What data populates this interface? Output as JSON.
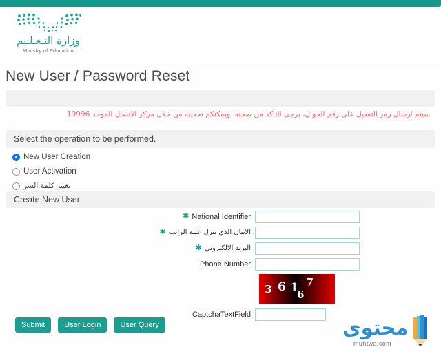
{
  "brand": {
    "logo_icon": "ministry-dots-logo",
    "name_ar": "وزارة التـعـلـيم",
    "name_en": "Ministry of Education",
    "accent_color": "#15998b"
  },
  "page": {
    "title": "New User / Password Reset"
  },
  "notice": {
    "text": "سيتم ارسال رمز التفعيل على رقم الجوال، يرجى التأكد من صحته، ويمكنكم تحديثه من خلال مركز الاتصال الموحد 19996",
    "color": "#f4626a"
  },
  "operation_section": {
    "heading": "Select the operation to be performed.",
    "options": [
      {
        "label": "New User Creation",
        "checked": true,
        "rtl": false
      },
      {
        "label": "User Activation",
        "checked": false,
        "rtl": false
      },
      {
        "label": "تغيير كلمة السر",
        "checked": false,
        "rtl": true
      }
    ]
  },
  "form_section": {
    "heading": "Create New User",
    "fields": [
      {
        "label": "National Identifier",
        "required": true,
        "rtl": false,
        "value": "",
        "placeholder": ""
      },
      {
        "label": "الايبان الذي ينزل عليه الراتب",
        "required": true,
        "rtl": true,
        "value": "",
        "placeholder": ""
      },
      {
        "label": "البريد الالكتروني",
        "required": true,
        "rtl": true,
        "value": "",
        "placeholder": ""
      },
      {
        "label": "Phone Number",
        "required": false,
        "rtl": false,
        "value": "",
        "placeholder": ""
      }
    ],
    "captcha": {
      "icon": "captcha-image",
      "code": "36167",
      "digits": [
        "3",
        "6",
        "1",
        "6",
        "7"
      ],
      "field_label": "CaptchaTextField",
      "field_value": "",
      "field_placeholder": ""
    }
  },
  "buttons": [
    {
      "label": "Submit",
      "name": "submit-button"
    },
    {
      "label": "User Login",
      "name": "user-login-button"
    },
    {
      "label": "User Query",
      "name": "user-query-button"
    }
  ],
  "watermark": {
    "text_ar": "محتوى",
    "url": "muhtwa.com",
    "icon": "pencil-icon",
    "color": "#2c8fd4"
  }
}
